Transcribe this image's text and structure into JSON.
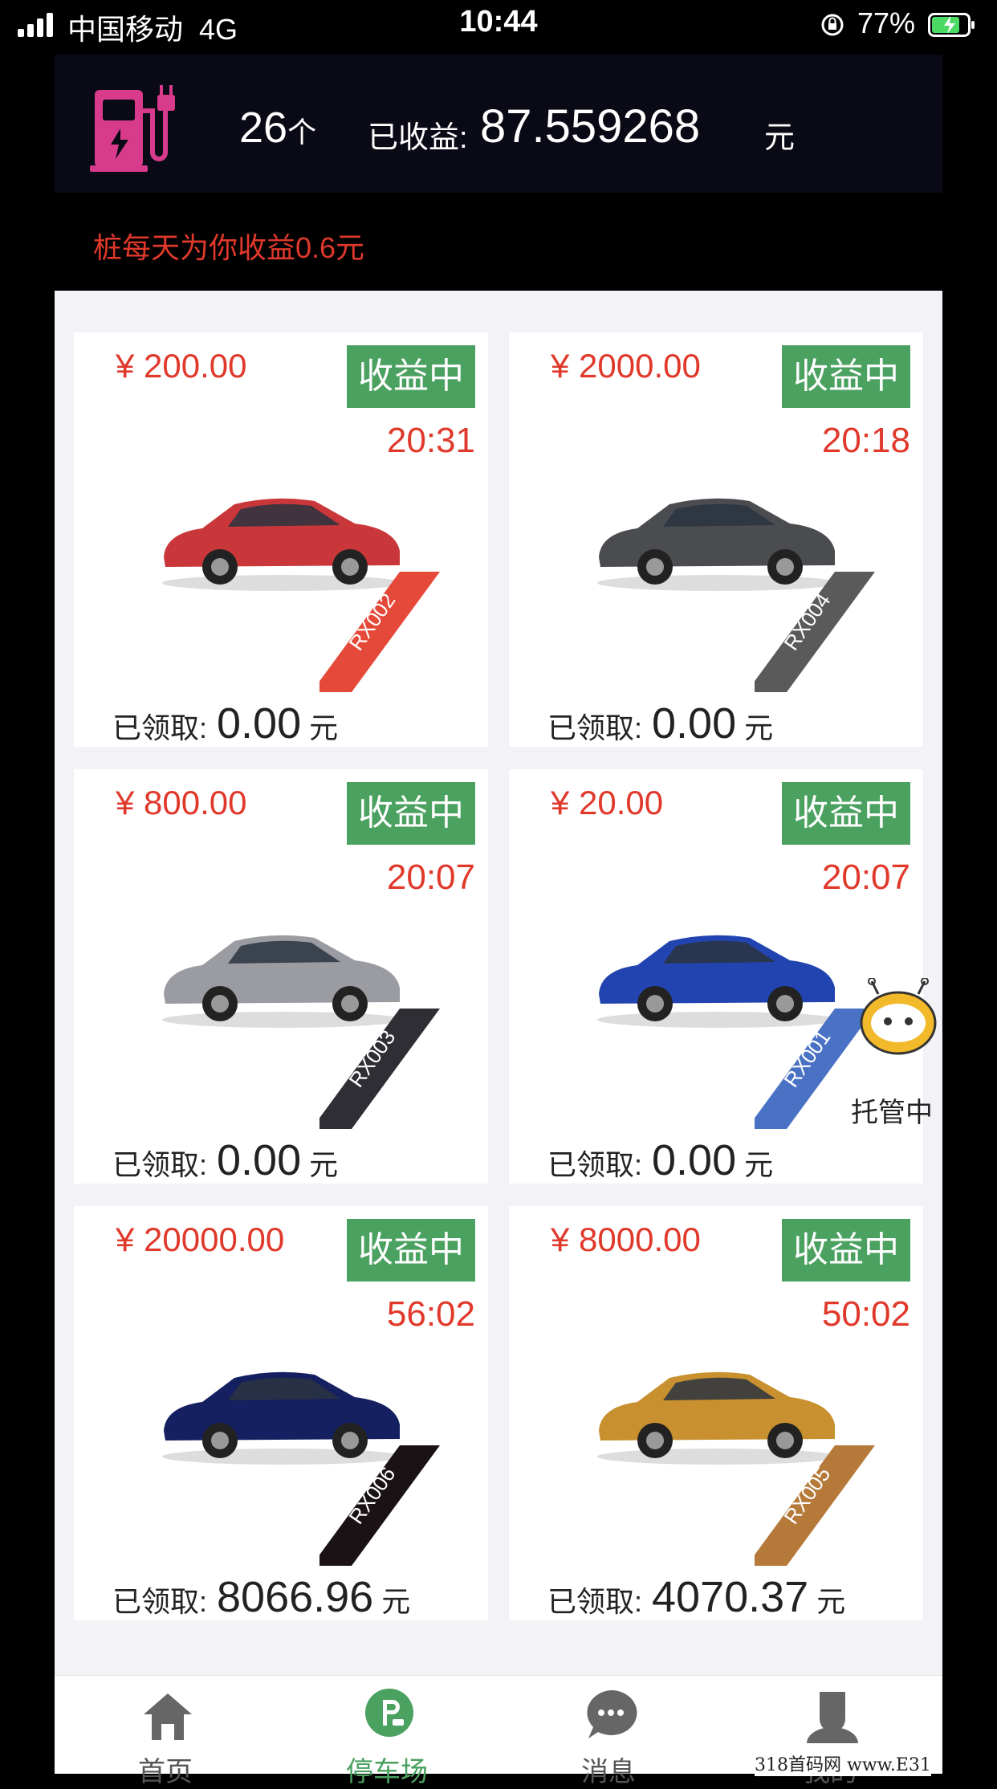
{
  "status_bar": {
    "carrier": "中国移动",
    "network": "4G",
    "time": "10:44",
    "battery": "77%"
  },
  "summary": {
    "count": "26",
    "count_unit": "个",
    "earnings_label": "已收益:",
    "earnings_value": "87.559268",
    "earnings_unit": "元"
  },
  "daily_note": "桩每天为你收益0.6元",
  "cards": [
    {
      "price": "¥ 200.00",
      "status": "收益中",
      "time": "20:31",
      "code": "RX002",
      "ribbon_color": "#e5493a",
      "car_color": "#c9373a",
      "claimed_label": "已领取:",
      "claimed_value": "0.00",
      "claimed_unit": "元"
    },
    {
      "price": "¥ 2000.00",
      "status": "收益中",
      "time": "20:18",
      "code": "RX004",
      "ribbon_color": "#5a5a5a",
      "car_color": "#4a4c50",
      "claimed_label": "已领取:",
      "claimed_value": "0.00",
      "claimed_unit": "元"
    },
    {
      "price": "¥ 800.00",
      "status": "收益中",
      "time": "20:07",
      "code": "RX003",
      "ribbon_color": "#2e2e34",
      "car_color": "#9a9ca2",
      "claimed_label": "已领取:",
      "claimed_value": "0.00",
      "claimed_unit": "元"
    },
    {
      "price": "¥ 20.00",
      "status": "收益中",
      "time": "20:07",
      "code": "RX001",
      "ribbon_color": "#4a72c4",
      "car_color": "#2244b0",
      "claimed_label": "已领取:",
      "claimed_value": "0.00",
      "claimed_unit": "元"
    },
    {
      "price": "¥ 20000.00",
      "status": "收益中",
      "time": "56:02",
      "code": "RX006",
      "ribbon_color": "#1a1214",
      "car_color": "#152060",
      "claimed_label": "已领取:",
      "claimed_value": "8066.96",
      "claimed_unit": "元"
    },
    {
      "price": "¥ 8000.00",
      "status": "收益中",
      "time": "50:02",
      "code": "RX005",
      "ribbon_color": "#b57a3a",
      "car_color": "#c8902e",
      "claimed_label": "已领取:",
      "claimed_value": "4070.37",
      "claimed_unit": "元"
    }
  ],
  "robot_label": "托管中",
  "tabs": [
    {
      "label": "首页",
      "icon": "home-icon"
    },
    {
      "label": "停车场",
      "icon": "parking-icon"
    },
    {
      "label": "消息",
      "icon": "message-icon"
    },
    {
      "label": "我的",
      "icon": "user-icon"
    }
  ],
  "watermark": "318首码网 www.E31"
}
